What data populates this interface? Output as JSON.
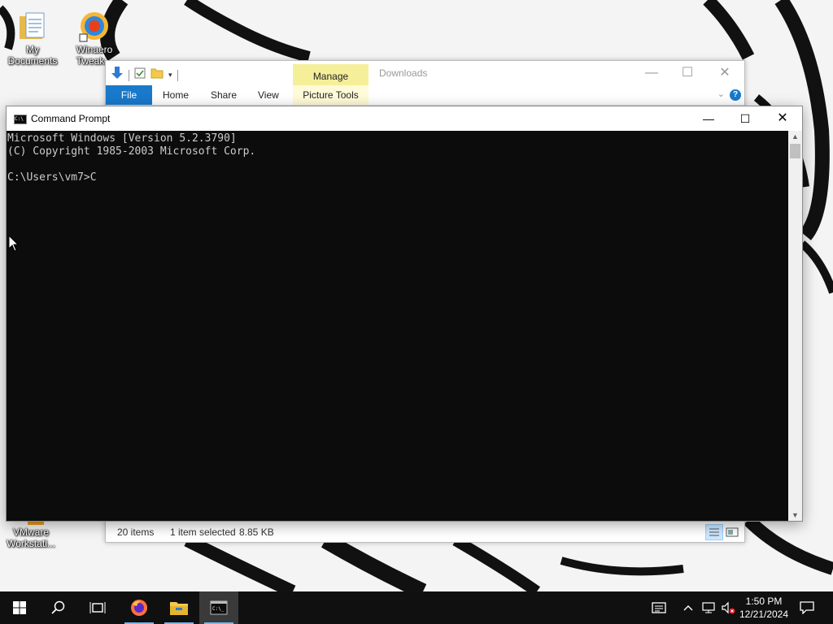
{
  "desktop": {
    "icons": [
      {
        "label_line1": "My",
        "label_line2": "Documents"
      },
      {
        "label_line1": "Winaero",
        "label_line2": "Tweak..."
      },
      {
        "label_line1": "VMware",
        "label_line2": "Workstati..."
      }
    ]
  },
  "explorer": {
    "title": "Downloads",
    "tab_manage": "Manage",
    "ribbon_tabs": {
      "file": "File",
      "home": "Home",
      "share": "Share",
      "view": "View",
      "picture_tools": "Picture Tools"
    },
    "help_glyph": "?",
    "status": {
      "items": "20 items",
      "selected": "1 item selected",
      "size": "8.85 KB"
    },
    "accent": "#1979ca",
    "manage_color": "#f5ef9a"
  },
  "cmd": {
    "title": "Command Prompt",
    "icon_glyph": "C:\\",
    "lines": [
      "Microsoft Windows [Version 5.2.3790]",
      "(C) Copyright 1985-2003 Microsoft Corp.",
      "",
      "C:\\Users\\vm7>C"
    ],
    "background": "#0c0c0c",
    "foreground": "#cccccc"
  },
  "taskbar": {
    "clock_time": "1:50 PM",
    "clock_date": "12/21/2024",
    "icons": [
      "windows-start-icon",
      "search-icon",
      "task-view-icon",
      "firefox-icon",
      "file-explorer-icon",
      "command-prompt-icon"
    ],
    "tray_icons": [
      "news-icon",
      "chevron-up-icon",
      "network-icon",
      "volume-muted-icon",
      "notifications-icon"
    ]
  }
}
